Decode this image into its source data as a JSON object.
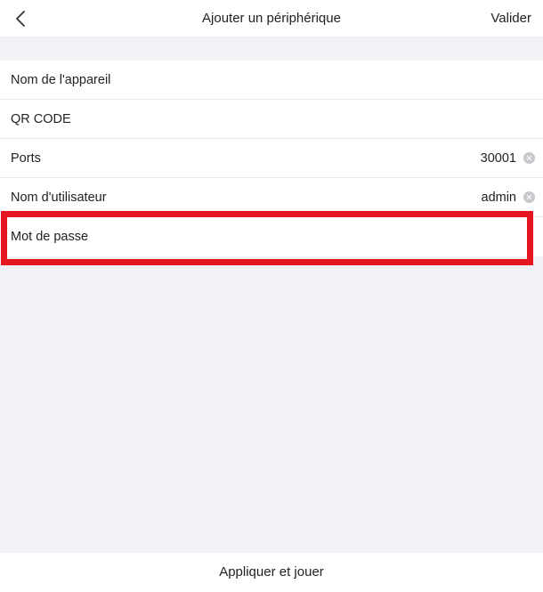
{
  "header": {
    "title": "Ajouter un périphérique",
    "validate_label": "Valider",
    "back_icon": "chevron-left-icon"
  },
  "form": {
    "rows": [
      {
        "label": "Nom de l'appareil",
        "value": ""
      },
      {
        "label": "QR CODE",
        "value": ""
      },
      {
        "label": "Ports",
        "value": "30001",
        "clear_icon": "clear-icon"
      },
      {
        "label": "Nom d'utilisateur",
        "value": "admin",
        "clear_icon": "clear-icon"
      },
      {
        "label": "Mot de passe",
        "value": ""
      }
    ]
  },
  "footer": {
    "action_label": "Appliquer et jouer"
  },
  "colors": {
    "background": "#f2f1f6",
    "surface": "#ffffff",
    "highlight": "#e5161f",
    "clear_icon": "#c7c7cc"
  }
}
